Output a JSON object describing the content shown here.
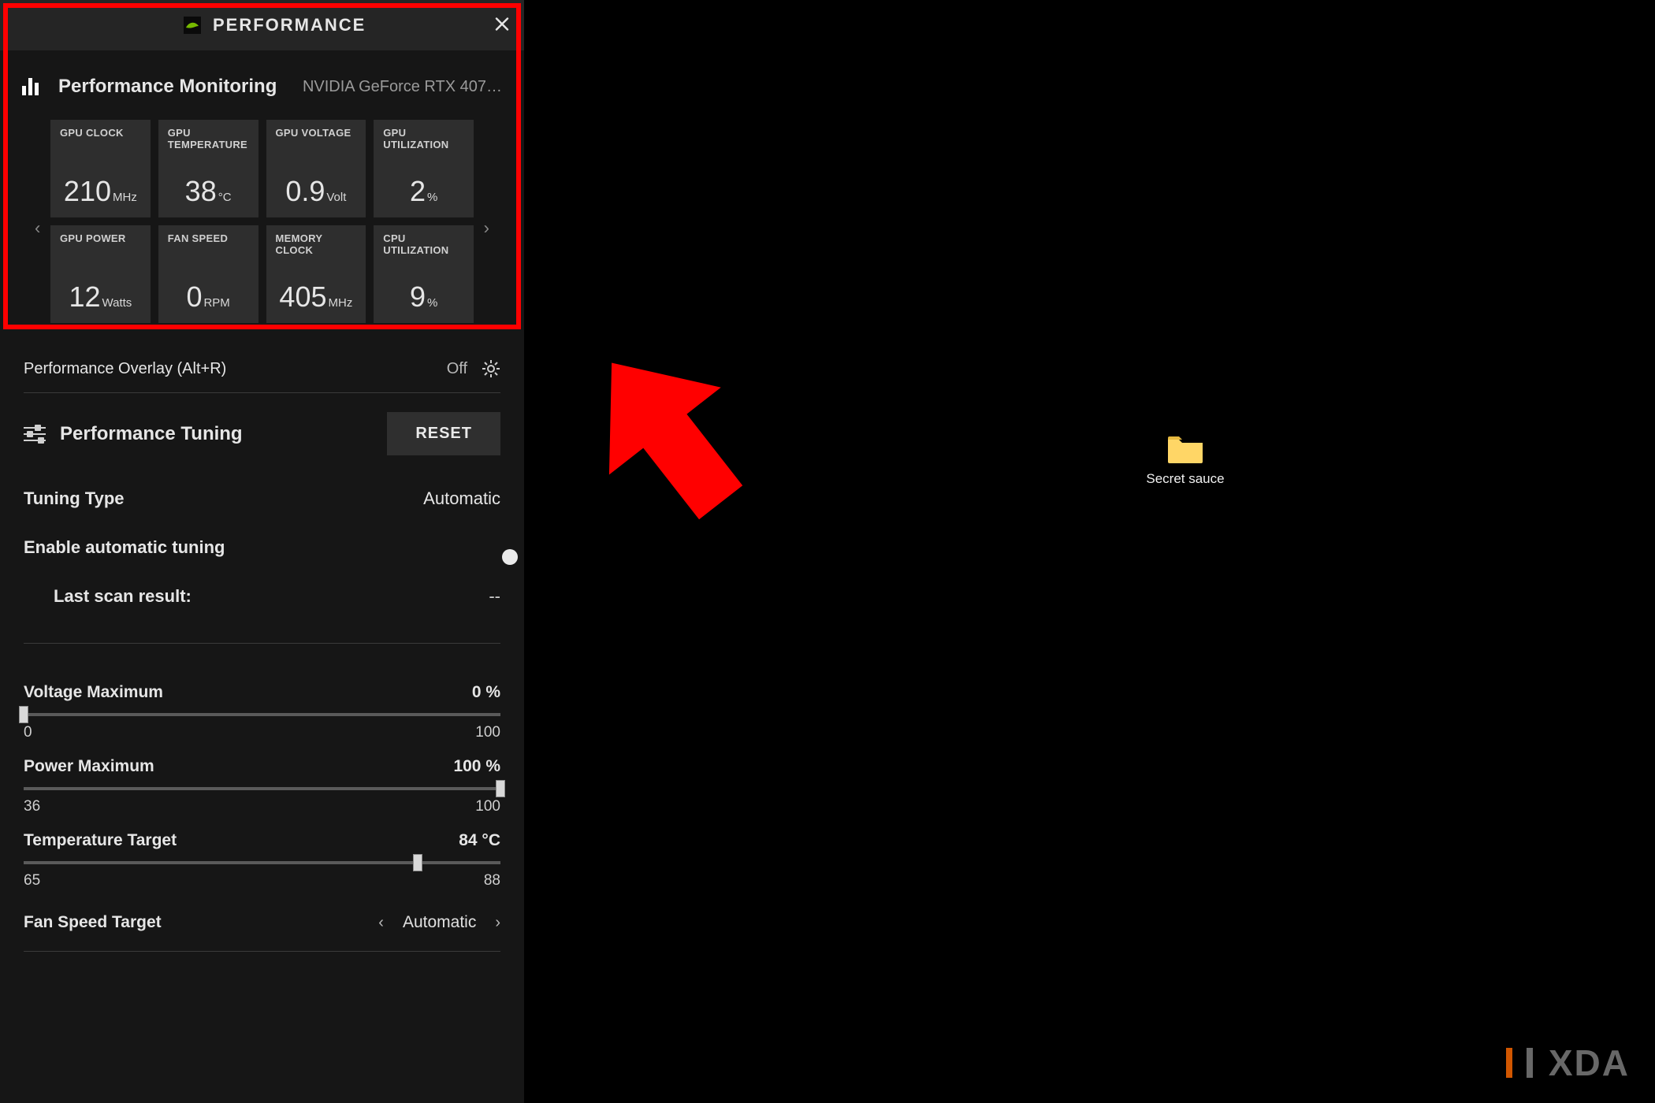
{
  "header": {
    "title": "PERFORMANCE"
  },
  "monitoring": {
    "title": "Performance Monitoring",
    "gpu": "NVIDIA GeForce RTX 407…",
    "tiles": [
      {
        "label": "GPU CLOCK",
        "value": "210",
        "unit": "MHz"
      },
      {
        "label": "GPU TEMPERATURE",
        "value": "38",
        "unit": "°C"
      },
      {
        "label": "GPU VOLTAGE",
        "value": "0.9",
        "unit": "Volt"
      },
      {
        "label": "GPU UTILIZATION",
        "value": "2",
        "unit": "%"
      },
      {
        "label": "GPU POWER",
        "value": "12",
        "unit": "Watts"
      },
      {
        "label": "FAN SPEED",
        "value": "0",
        "unit": "RPM"
      },
      {
        "label": "MEMORY CLOCK",
        "value": "405",
        "unit": "MHz"
      },
      {
        "label": "CPU UTILIZATION",
        "value": "9",
        "unit": "%"
      }
    ]
  },
  "overlay": {
    "label": "Performance Overlay (Alt+R)",
    "state": "Off"
  },
  "tuning": {
    "title": "Performance Tuning",
    "reset": "RESET",
    "type_label": "Tuning Type",
    "type_value": "Automatic",
    "auto_label": "Enable automatic tuning",
    "auto_on": false,
    "last_scan_label": "Last scan result:",
    "last_scan_value": "--"
  },
  "sliders": {
    "voltage": {
      "label": "Voltage Maximum",
      "value": "0 %",
      "lo": "0",
      "hi": "100",
      "pos": 0
    },
    "power": {
      "label": "Power Maximum",
      "value": "100 %",
      "lo": "36",
      "hi": "100",
      "pos": 100
    },
    "temp": {
      "label": "Temperature Target",
      "value": "84 °C",
      "lo": "65",
      "hi": "88",
      "pos": 82.6
    }
  },
  "fan": {
    "label": "Fan Speed Target",
    "value": "Automatic"
  },
  "desktop": {
    "folder_label": "Secret sauce"
  },
  "watermark": {
    "text": "XDA"
  }
}
